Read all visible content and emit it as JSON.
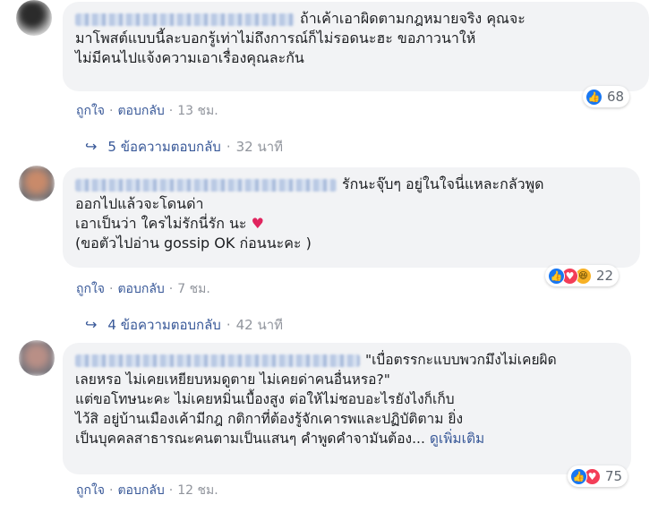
{
  "comments": [
    {
      "lines": [
        "ถ้าเค้าเอาผิดตามกฎหมายจริง คุณจะ",
        "มาโพสต์แบบนี้ละบอกรู้เท่าไม่ถึงการณ์ก็ไม่รอดนะฮะ ขอภาวนาให้",
        "ไม่มีคนไปแจ้งความเอาเรื่องคุณละกัน"
      ],
      "reaction_count": "68",
      "like_label": "ถูกใจ",
      "reply_label": "ตอบกลับ",
      "time": "13 ชม.",
      "replies_label": "5 ข้อความตอบกลับ",
      "replies_time": "32 นาที"
    },
    {
      "lines": [
        "รักนะจุ๊บๆ อยู่ในใจนี่แหละกลัวพูด",
        "ออกไปแล้วจะโดนด่า",
        "เอาเป็นว่า ใครไม่รักนี่รัก นะ",
        "(ขอตัวไปอ่าน gossip OK ก่อนนะคะ )"
      ],
      "heart": "♥",
      "reaction_count": "22",
      "like_label": "ถูกใจ",
      "reply_label": "ตอบกลับ",
      "time": "7 ชม.",
      "replies_label": "4 ข้อความตอบกลับ",
      "replies_time": "42 นาที"
    },
    {
      "lines": [
        "\"เบื่อตรรกะแบบพวกมึงไม่เคยผิด",
        "เลยหรอ ไม่เคยเหยียบหมดูตาย ไม่เคยด่าคนอื่นหรอ?\"",
        "แต่ขอโทษนะคะ ไม่เคยหมิ่นเบื้องสูง ต่อให้ไม่ชอบอะไรยังไงก็เก็บ",
        "ไว้สิ อยู่บ้านเมืองเค้ามีกฎ กติกาที่ต้องรู้จักเคารพและปฏิบัติตาม ยิ่ง",
        "เป็นบุคคลสาธารณะคนตามเป็นแสนๆ คำพูดคำจามันต้อง..."
      ],
      "see_more": "ดูเพิ่มเติม",
      "reaction_count": "75",
      "like_label": "ถูกใจ",
      "reply_label": "ตอบกลับ",
      "time": "12 ชม."
    }
  ]
}
